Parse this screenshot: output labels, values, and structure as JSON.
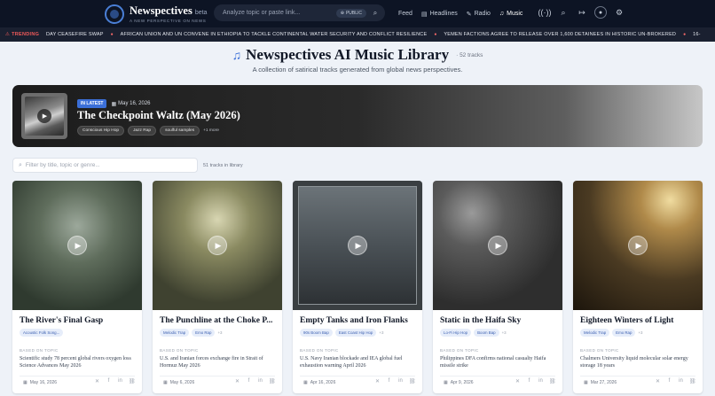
{
  "header": {
    "brand_name": "Newspectives",
    "brand_beta": "beta",
    "brand_tagline": "A NEW PERSPECTIVE ON NEWS",
    "search_placeholder": "Analyze topic or paste link...",
    "public_label": "PUBLIC",
    "nav": [
      {
        "label": "Feed",
        "icon": ""
      },
      {
        "label": "Headlines",
        "icon": "newspaper-icon"
      },
      {
        "label": "Radio",
        "icon": "radio-icon"
      },
      {
        "label": "Music",
        "icon": "music-note-icon"
      }
    ],
    "icons": [
      "broadcast-icon",
      "search-icon",
      "login-icon",
      "user-icon",
      "gear-icon"
    ]
  },
  "ticker": {
    "label": "TRENDING",
    "items": [
      "DAY CEASEFIRE SWAP",
      "AFRICAN UNION AND UN CONVENE IN ETHIOPIA TO TACKLE CONTINENTAL WATER SECURITY AND CONFLICT RESILIENCE",
      "YEMEN FACTIONS AGREE TO RELEASE OVER 1,600 DETAINEES IN HISTORIC UN-BROKERED",
      "16-"
    ]
  },
  "library": {
    "title": "Newspectives AI Music Library",
    "count": "52 tracks",
    "subtitle": "A collection of satirical tracks generated from global news perspectives."
  },
  "featured": {
    "badge": "IN LATEST",
    "date": "May 16, 2026",
    "title": "The Checkpoint Waltz (May 2026)",
    "tags": [
      "Conscious Hip Hop",
      "Jazz Rap",
      "soulful samples"
    ],
    "more": "+1 more"
  },
  "filter": {
    "placeholder": "Filter by title, topic or genre...",
    "count": "51 tracks in library"
  },
  "cards": [
    {
      "title": "The River's Final Gasp",
      "tags": [
        "Acoustic Folk Song..."
      ],
      "more": "",
      "based_label": "BASED ON TOPIC",
      "topic": "Scientific study 78 percent global rivers oxygen loss Science Advances May 2026",
      "date": "May 16, 2026",
      "art_color": "#4c5a4a"
    },
    {
      "title": "The Punchline at the Choke P...",
      "tags": [
        "Melodic Trap",
        "Emo Rap"
      ],
      "more": "+3",
      "based_label": "BASED ON TOPIC",
      "topic": "U.S. and Iranian forces exchange fire in Strait of Hormuz May 2026",
      "date": "May 6, 2026",
      "art_color": "#5d6346"
    },
    {
      "title": "Empty Tanks and Iron Flanks",
      "tags": [
        "90s Boom Bap",
        "East Coast Hip Hop"
      ],
      "more": "+3",
      "based_label": "BASED ON TOPIC",
      "topic": "U.S. Navy Iranian blockade and IEA global fuel exhaustion warning April 2026",
      "date": "Apr 16, 2026",
      "art_color": "#4a5156"
    },
    {
      "title": "Static in the Haifa Sky",
      "tags": [
        "Lo-Fi Hip Hop",
        "Boom Bap"
      ],
      "more": "+3",
      "based_label": "BASED ON TOPIC",
      "topic": "Philippines DFA confirms national casualty Haifa missile strike",
      "date": "Apr 9, 2026",
      "art_color": "#3d3d3d"
    },
    {
      "title": "Eighteen Winters of Light",
      "tags": [
        "Melodic Trap",
        "Emo Rap"
      ],
      "more": "+3",
      "based_label": "BASED ON TOPIC",
      "topic": "Chalmers University liquid molecular solar energy storage 18 years",
      "date": "Mar 27, 2026",
      "art_color": "#5a4a2e"
    }
  ],
  "share_icons": [
    "x-icon",
    "facebook-icon",
    "linkedin-icon",
    "link-icon"
  ]
}
